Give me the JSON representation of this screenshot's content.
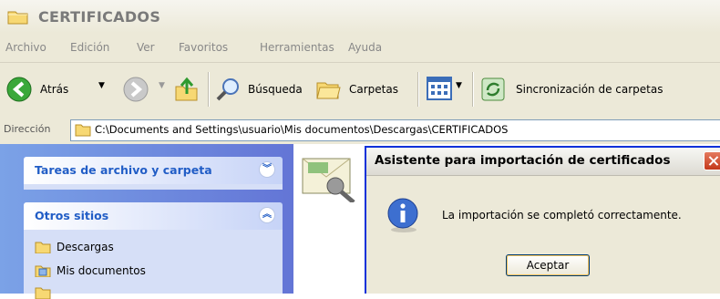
{
  "window": {
    "title": "CERTIFICADOS"
  },
  "menu": {
    "items": [
      "Archivo",
      "Edición",
      "Ver",
      "Favoritos",
      "Herramientas",
      "Ayuda"
    ]
  },
  "toolbar": {
    "back_label": "Atrás",
    "search_label": "Búsqueda",
    "folders_label": "Carpetas",
    "sync_label": "Sincronización de carpetas"
  },
  "address": {
    "label": "Dirección",
    "value": "C:\\Documents and Settings\\usuario\\Mis documentos\\Descargas\\CERTIFICADOS"
  },
  "taskpane": {
    "file_tasks_title": "Tareas de archivo y carpeta",
    "other_places_title": "Otros sitios",
    "other_places": [
      "Descargas",
      "Mis documentos"
    ]
  },
  "dialog": {
    "title": "Asistente para importación de certificados",
    "message": "La importación se completó correctamente.",
    "ok_label": "Aceptar"
  },
  "colors": {
    "taskpane_gradient_start": "#7ba2e7",
    "taskpane_gradient_end": "#6375d6",
    "dialog_border": "#0831d9",
    "close_button": "#c4381a"
  }
}
